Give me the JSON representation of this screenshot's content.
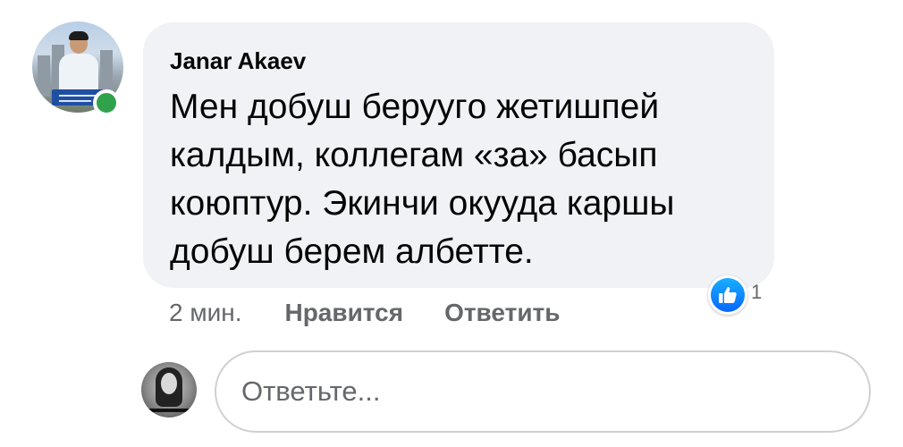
{
  "comment": {
    "author": "Janar Akaev",
    "text": "Мен добуш беруугo жетишпей калдым, коллегам «за» басып коюптур. Экинчи окууда каршы добуш берем албетте.",
    "timestamp": "2 мин.",
    "like_label": "Нравится",
    "reply_label": "Ответить",
    "reaction_icon": "like-icon",
    "reaction_count": "1",
    "author_online": true
  },
  "reply_box": {
    "placeholder": "Ответьте..."
  },
  "colors": {
    "bubble_bg": "#f0f2f5",
    "online_green": "#31a24c",
    "like_blue": "#0866ff",
    "secondary_text": "#65676b"
  }
}
